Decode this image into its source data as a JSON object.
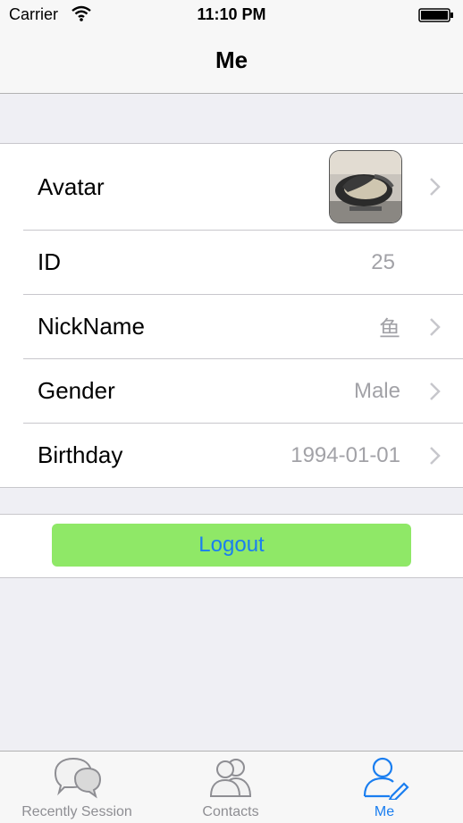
{
  "status_bar": {
    "carrier": "Carrier",
    "time": "11:10 PM"
  },
  "nav": {
    "title": "Me"
  },
  "profile": {
    "avatar_label": "Avatar",
    "id_label": "ID",
    "id_value": "25",
    "nickname_label": "NickName",
    "nickname_value": "鱼",
    "gender_label": "Gender",
    "gender_value": "Male",
    "birthday_label": "Birthday",
    "birthday_value": "1994-01-01"
  },
  "logout": {
    "label": "Logout"
  },
  "tabs": [
    {
      "label": "Recently Session",
      "icon": "chat-bubbles-icon"
    },
    {
      "label": "Contacts",
      "icon": "contacts-icon"
    },
    {
      "label": "Me",
      "icon": "me-edit-icon"
    }
  ],
  "colors": {
    "accent": "#1a7ef0",
    "logout_bg": "#8fe867",
    "secondary_text": "#a2a2a7"
  }
}
